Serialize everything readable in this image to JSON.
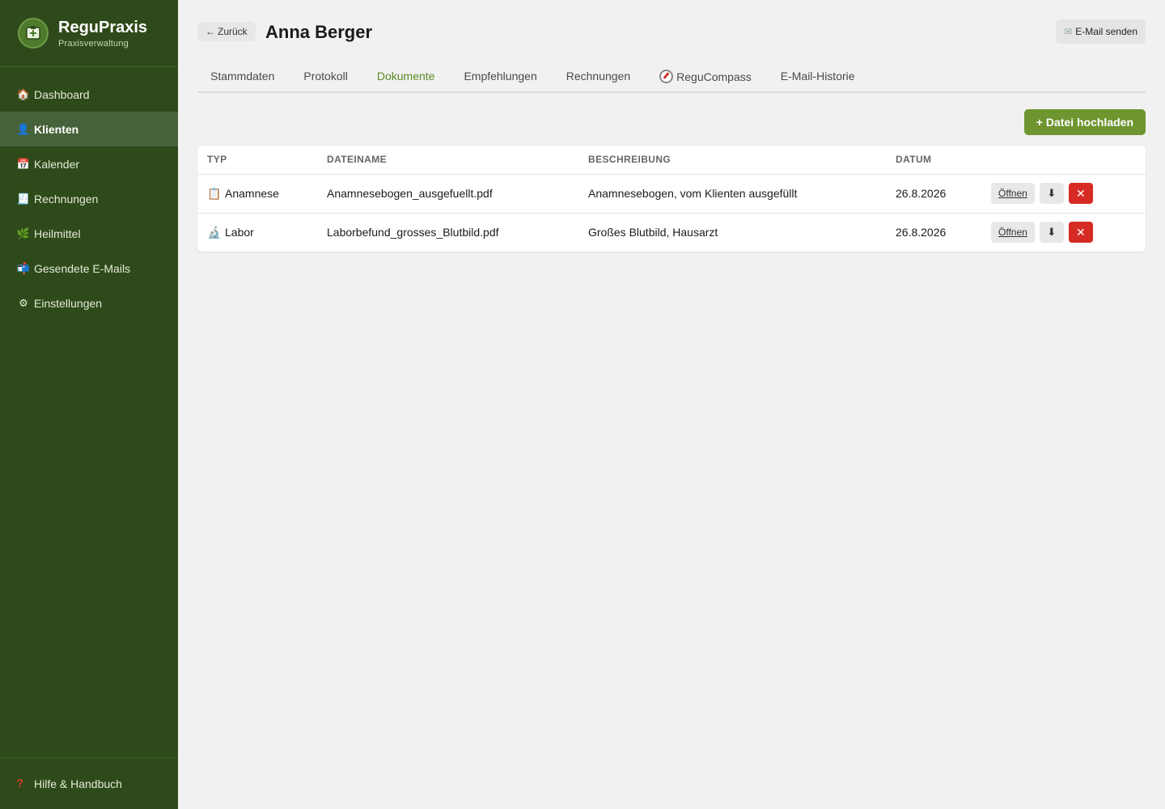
{
  "app": {
    "name": "ReguPraxis",
    "subtitle": "Praxisverwaltung"
  },
  "sidebar": {
    "items": [
      {
        "label": "Dashboard",
        "icon": "house-icon"
      },
      {
        "label": "Klienten",
        "icon": "person-icon",
        "active": true
      },
      {
        "label": "Kalender",
        "icon": "calendar-icon"
      },
      {
        "label": "Rechnungen",
        "icon": "invoice-icon"
      },
      {
        "label": "Heilmittel",
        "icon": "herb-icon"
      },
      {
        "label": "Gesendete E-Mails",
        "icon": "mailbox-icon"
      },
      {
        "label": "Einstellungen",
        "icon": "gear-icon"
      }
    ],
    "help_label": "Hilfe & Handbuch"
  },
  "header": {
    "back_label": "Zurück",
    "title": "Anna Berger",
    "email_button_label": "E-Mail senden"
  },
  "tabs": [
    {
      "label": "Stammdaten"
    },
    {
      "label": "Protokoll"
    },
    {
      "label": "Dokumente",
      "active": true
    },
    {
      "label": "Empfehlungen"
    },
    {
      "label": "Rechnungen"
    },
    {
      "label": "ReguCompass",
      "icon": "compass-icon"
    },
    {
      "label": "E-Mail-Historie"
    }
  ],
  "toolbar": {
    "upload_label": "+ Datei hochladen"
  },
  "table": {
    "columns": [
      "TYP",
      "DATEINAME",
      "BESCHREIBUNG",
      "DATUM"
    ],
    "rows": [
      {
        "typ": "Anamnese",
        "typ_icon": "clipboard-icon",
        "dateiname": "Anamnesebogen_ausgefuellt.pdf",
        "beschreibung": "Anamnesebogen, vom Klienten ausgefüllt",
        "datum": "26.8.2026"
      },
      {
        "typ": "Labor",
        "typ_icon": "microscope-icon",
        "dateiname": "Laborbefund_grosses_Blutbild.pdf",
        "beschreibung": "Großes Blutbild, Hausarzt",
        "datum": "26.8.2026"
      }
    ],
    "open_label": "Öffnen"
  },
  "colors": {
    "sidebar_bg": "#2f4a1a",
    "accent": "#6e952f",
    "active_tab": "#5a8a24",
    "danger": "#d52b24"
  }
}
